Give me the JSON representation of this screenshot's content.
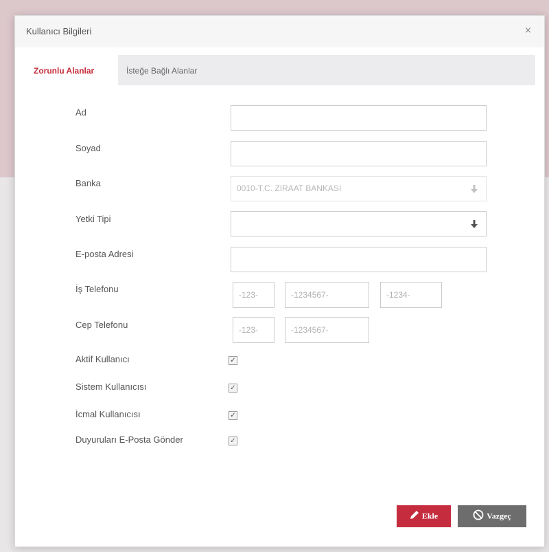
{
  "dialog": {
    "title": "Kullanıcı Bilgileri",
    "close_symbol": "×"
  },
  "tabs": [
    {
      "label": "Zorunlu Alanlar",
      "active": true
    },
    {
      "label": "İsteğe Bağlı Alanlar",
      "active": false
    }
  ],
  "form": {
    "ad": {
      "label": "Ad",
      "value": ""
    },
    "soyad": {
      "label": "Soyad",
      "value": ""
    },
    "banka": {
      "label": "Banka",
      "value": "0010-T.C. ZIRAAT BANKASI",
      "disabled": true
    },
    "yetki_tipi": {
      "label": "Yetki Tipi",
      "value": ""
    },
    "eposta": {
      "label": "E-posta Adresi",
      "value": ""
    },
    "is_telefonu": {
      "label": "İş Telefonu",
      "placeholders": [
        "-123-",
        "-1234567-",
        "-1234-"
      ]
    },
    "cep_telefonu": {
      "label": "Cep Telefonu",
      "placeholders": [
        "-123-",
        "-1234567-"
      ]
    },
    "checkboxes": [
      {
        "label": "Aktif Kullanıcı",
        "checked": true
      },
      {
        "label": "Sistem Kullanıcısı",
        "checked": true
      },
      {
        "label": "İcmal Kullanıcısı",
        "checked": true
      },
      {
        "label": "Duyuruları E-Posta Gönder",
        "checked": true
      }
    ],
    "check_glyph": "✓"
  },
  "buttons": {
    "add_label": "Ekle",
    "cancel_label": "Vazgeç"
  },
  "icons": {
    "dropdown": "arrow-down-icon",
    "add": "pencil-icon",
    "cancel": "ban-icon"
  },
  "colors": {
    "accent": "#c72e3c",
    "add_button": "#c52d3e",
    "cancel_button": "#6d6d6d",
    "tab_bar": "#ececee"
  }
}
